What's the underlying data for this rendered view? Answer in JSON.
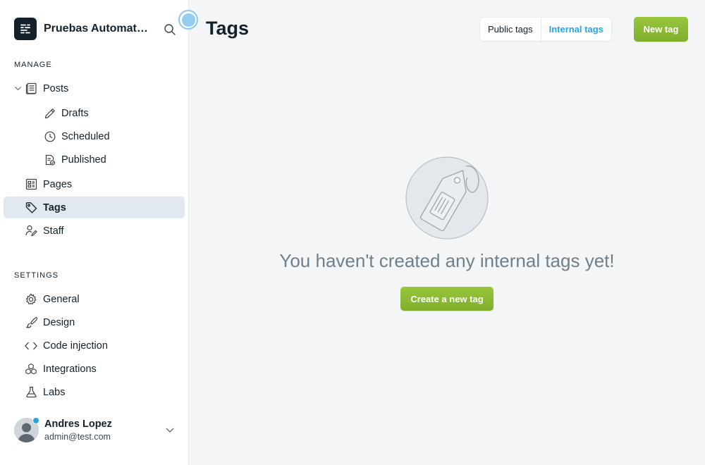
{
  "site": {
    "title": "Pruebas Automatización"
  },
  "sidebar": {
    "manage_label": "MANAGE",
    "settings_label": "SETTINGS",
    "manage_items": [
      {
        "label": "Posts",
        "icon": "posts-icon"
      },
      {
        "label": "Drafts",
        "icon": "pencil-icon"
      },
      {
        "label": "Scheduled",
        "icon": "clock-icon"
      },
      {
        "label": "Published",
        "icon": "published-icon"
      },
      {
        "label": "Pages",
        "icon": "pages-icon"
      },
      {
        "label": "Tags",
        "icon": "tag-icon",
        "active": true
      },
      {
        "label": "Staff",
        "icon": "staff-icon"
      }
    ],
    "settings_items": [
      {
        "label": "General",
        "icon": "gear-icon"
      },
      {
        "label": "Design",
        "icon": "brush-icon"
      },
      {
        "label": "Code injection",
        "icon": "code-icon"
      },
      {
        "label": "Integrations",
        "icon": "integrations-icon"
      },
      {
        "label": "Labs",
        "icon": "flask-icon"
      }
    ]
  },
  "user": {
    "name": "Andres Lopez",
    "email": "admin@test.com"
  },
  "main": {
    "title": "Tags",
    "tabs": [
      {
        "label": "Public tags",
        "active": false
      },
      {
        "label": "Internal tags",
        "active": true
      }
    ],
    "new_tag_label": "New tag",
    "empty_message": "You haven't created any internal tags yet!",
    "create_label": "Create a new tag"
  },
  "colors": {
    "accent_green": "#8bba34",
    "accent_blue": "#2aa3e6",
    "active_nav": "#e1e8f0"
  }
}
